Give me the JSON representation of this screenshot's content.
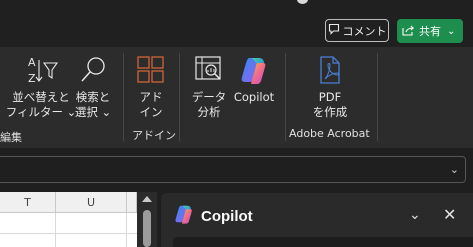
{
  "header": {
    "comment_label": "コメント",
    "share_label": "共有",
    "share_chevron": "⌄"
  },
  "ribbon": {
    "edit_group_label_fragment": "編集",
    "sort_filter": {
      "line1": "並べ替えと",
      "line2": "フィルター ⌄"
    },
    "find_select": {
      "line1": "検索と",
      "line2": "選択 ⌄"
    },
    "addins": {
      "line1": "アド",
      "line2": "イン",
      "group_label": "アドイン"
    },
    "data_analysis": {
      "line1": "データ",
      "line2": "分析"
    },
    "copilot": {
      "label": "Copilot"
    },
    "pdf_create": {
      "line1": "PDF",
      "line2": "を作成",
      "group_label": "Adobe Acrobat"
    }
  },
  "formula_bar": {
    "chevron": "⌄"
  },
  "grid": {
    "columns": [
      "T",
      "U"
    ]
  },
  "copilot_pane": {
    "title": "Copilot",
    "minimize_glyph": "⌄",
    "close_glyph": "✕"
  },
  "colors": {
    "ribbon_bg": "#2c2c2c",
    "share_green": "#1e8e4e",
    "addins_orange": "#d0653a",
    "pdf_blue": "#4a7fd4"
  },
  "icons": [
    "comment-icon",
    "share-icon",
    "sort-filter-icon",
    "search-icon",
    "addins-icon",
    "data-analysis-icon",
    "copilot-logo-icon",
    "pdf-icon"
  ]
}
